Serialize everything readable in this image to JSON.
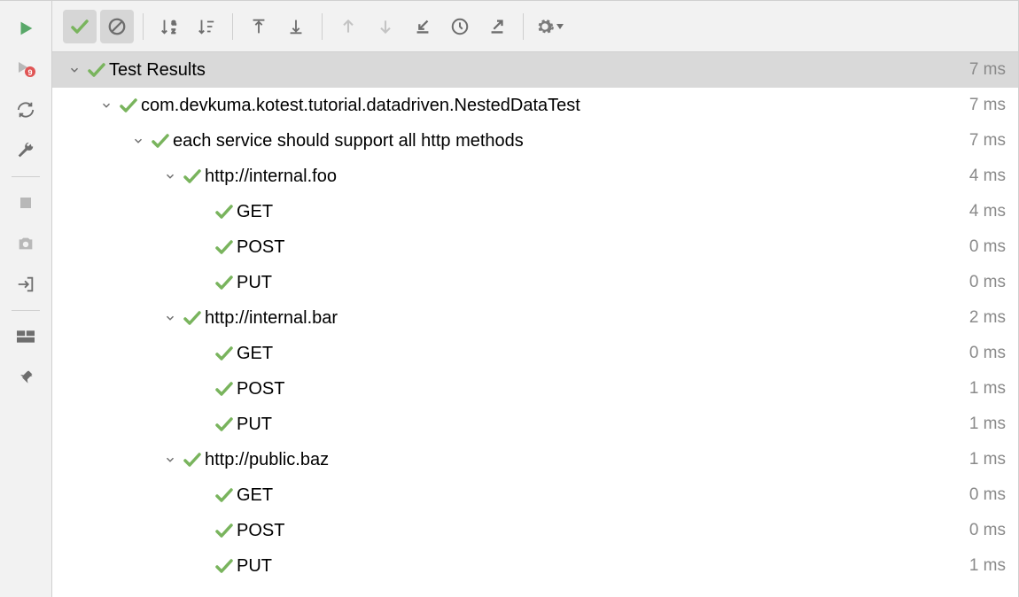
{
  "colors": {
    "pass": "#79b45d",
    "run": "#59a869",
    "icon": "#6e6e6e",
    "disabled": "#b8b8b8"
  },
  "root": {
    "label": "Test Results",
    "time": "7 ms"
  },
  "tree": [
    {
      "depth": 0,
      "expand": true,
      "label": "com.devkuma.kotest.tutorial.datadriven.NestedDataTest",
      "time": "7 ms"
    },
    {
      "depth": 1,
      "expand": true,
      "label": "each service should support all http methods",
      "time": "7 ms"
    },
    {
      "depth": 2,
      "expand": true,
      "label": "http://internal.foo",
      "time": "4 ms"
    },
    {
      "depth": 3,
      "expand": false,
      "label": "GET",
      "time": "4 ms"
    },
    {
      "depth": 3,
      "expand": false,
      "label": "POST",
      "time": "0 ms"
    },
    {
      "depth": 3,
      "expand": false,
      "label": "PUT",
      "time": "0 ms"
    },
    {
      "depth": 2,
      "expand": true,
      "label": "http://internal.bar",
      "time": "2 ms"
    },
    {
      "depth": 3,
      "expand": false,
      "label": "GET",
      "time": "0 ms"
    },
    {
      "depth": 3,
      "expand": false,
      "label": "POST",
      "time": "1 ms"
    },
    {
      "depth": 3,
      "expand": false,
      "label": "PUT",
      "time": "1 ms"
    },
    {
      "depth": 2,
      "expand": true,
      "label": "http://public.baz",
      "time": "1 ms"
    },
    {
      "depth": 3,
      "expand": false,
      "label": "GET",
      "time": "0 ms"
    },
    {
      "depth": 3,
      "expand": false,
      "label": "POST",
      "time": "0 ms"
    },
    {
      "depth": 3,
      "expand": false,
      "label": "PUT",
      "time": "1 ms"
    }
  ]
}
